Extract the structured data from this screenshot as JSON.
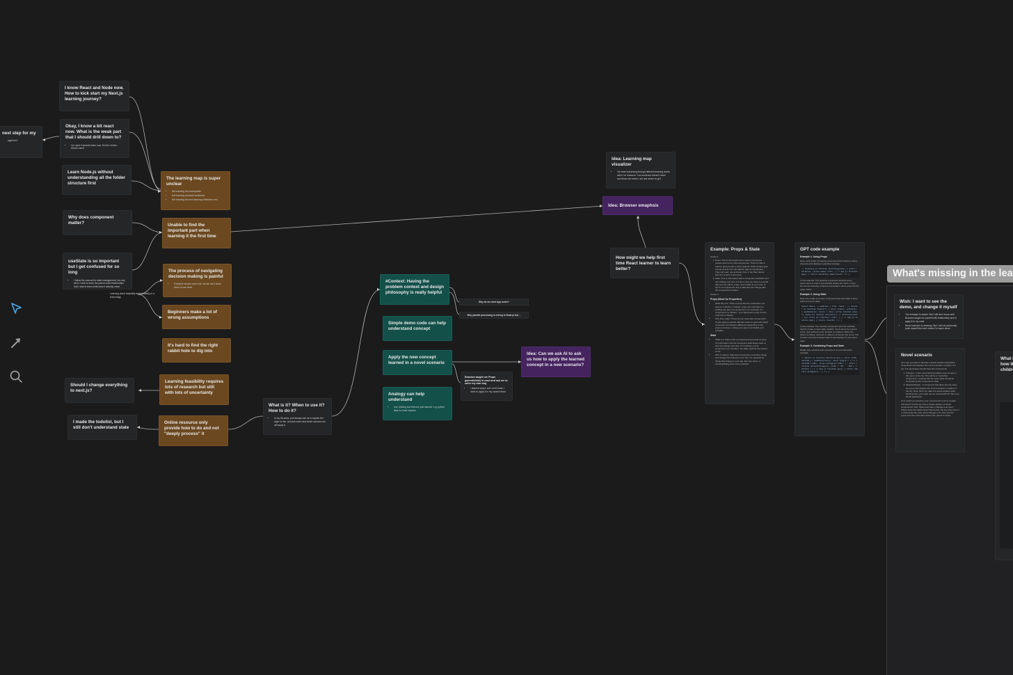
{
  "cards": {
    "next_step": {
      "title": "next step for my",
      "bullets": [
        "agement?"
      ]
    },
    "know_react_node": {
      "title": "I know React and Node now. How to kick start my Next.js learning journey?"
    },
    "weak_part": {
      "title": "Okay, I know a bit react now. What is the weak part that I should drill down to?",
      "bullets": [
        "I've used it several times now. So let's review. What's hard?"
      ]
    },
    "learn_node": {
      "title": "Learn Node.js without understanding all the folder structure first"
    },
    "component_matter": {
      "title": "Why does component matter?"
    },
    "usestate": {
      "title": "useState is so important but I get confused for so long",
      "bullets": [
        "I follow the manual for state management, but only when I start to learn the parent child relationships that I start to learn what does it actually mean"
      ]
    },
    "should_change": {
      "title": "Should I change everything to next.js?"
    },
    "made_todolist": {
      "title": "I made the todolist, but I still don't understand state"
    },
    "learning_map": {
      "title": "The learning map is super unclear",
      "bullets": [
        "Not knowing the prerequisite",
        "Not knowing personal weakness",
        "Not knowing the next learning milestone next"
      ]
    },
    "unable_find": {
      "title": "Unable to find the important part when learning it the first time"
    },
    "navigating": {
      "title": "The process of navigating decision making is painful",
      "bullets": [
        "Everyone knows some tool, but we don't know when to use what."
      ]
    },
    "beginners": {
      "title": "Beginners make a lot of wrong assumptions"
    },
    "rabbit_hole": {
      "title": "It's hard to find the right rabbit hole to dig into"
    },
    "feasibility": {
      "title": "Learning feasibility requires lots of research but still with lots of uncertainty"
    },
    "online_resource": {
      "title": "Online resource only provide how to do and not \"deeply process\" it"
    },
    "what_is_it": {
      "title": "What is it? When to use it? How to do it?",
      "bullets": [
        "In my 9A class, prof always ask us to explain the algor to him, and ask when and which scenario we will apply it."
      ]
    },
    "context": {
      "title": "#Context: Having the problem context and design philosophy is really helpful"
    },
    "simple_demo": {
      "title": "Simple demo code can help understand concept"
    },
    "apply_new": {
      "title": "Apply the new concept learned in a novel scenario"
    },
    "analogy": {
      "title": "Analogy can help understand",
      "bullets": [
        "Use existing tool that one just learned. e.g. python flask to Node express"
      ]
    },
    "brandon": {
      "title": "Brandon taught me Props (parent/child) in react and ask me to solve my own bug",
      "bullets": [
        "I learned props, but I don't know I need to apply it in my context there"
      ]
    },
    "idea_ai": {
      "title": "Idea: Can we ask AI to ask us how to apply the learned concept in a new scenario?"
    },
    "idea_map": {
      "title": "Idea: Learning map visualizer",
      "bullets": [
        "I've been traversing through different learning levels when I'm research. Can someone break it down and show me where I am and where to go?"
      ]
    },
    "idea_browser": {
      "title": "Idea: Browser emaphsis"
    },
    "how_might": {
      "title": "How might we help first time React learner to learn better?"
    },
    "wish": {
      "title": "Wish: I want to see the demo, and change it myself",
      "bullets": [
        "The example is simple. But I still don't know until Brandon taught me parent/child relationship and to apply it in my code.",
        "Novel scenario is amazing. But I will not personally push myself this hard unless I'm super stuck."
      ]
    },
    "novel": {
      "title": "Novel scenario",
      "body": "Let's say you want to develop a simple weather application using React that displays the current weather condition of a city. The application should have two components:",
      "items": [
        "CityInput - A form input field that allows users to type in the name of the city. This will be a \"controlled component\", meaning that the input value should be controlled by the component's state.",
        "WeatherDisplay - A component that takes the city name as a prop and displays the current weather condition of the city. Note: We'll not make the actual weather data fetching here, you might use an external API for that in an actual application."
      ],
      "foot": "How would you structure your components in terms of state and props? Could you write a simple skeleton of those components? Hint: What information changes over time? Where does information flow? Remember, the key thing here is to think about the state (what changes over time) and the props (how the information flows from parent to child)."
    },
    "partial": {
      "title": "What i how th childre"
    }
  },
  "tiny_notes": {
    "app_router": "Why do we need App router?",
    "parallel": "Why parallel processing is a thing in Node.js but ..."
  },
  "floating_label": "Learning about feasibility and suitability of a technology",
  "section_title": "What's missing in the lea",
  "docs": {
    "props_state": {
      "title": "Example: Props & State",
      "output1": "Output 1:",
      "p1": "Props: This is information that a parent component passes down to its child components. Think of it like a teacher giving books to their students. Each student gets a book (props) from the teacher (parent component). They can read, use and learn from it, but they cannot alter the content of the book.",
      "p2": "State: This is information that a component maintains and can change over time. It's like a note you write to yourself that you can add to, erase, and modify as you need. In terms of components, this is data that can change after the component is loaded.",
      "output2": "Output 2:",
      "props_head": "Props (Short for Properties)",
      "p3": "What they are: Think of props like the parameters you pass to a function. In React, props are information or settings you give to a component. For example, if a component is a \"Button\", you might pass a prop to tell it what text to display.",
      "p4": "Why they matter: Props let you customize components. It's like giving a painter different colors to paint with. Each component can behave differently depending on the props it receives, making your app more flexible and reusable.",
      "state_head": "State",
      "p5": "What it is: State is like a component's personal memory. It's information that the component itself keeps track of and can change over time. For instance, if your component is a \"Counter\", the state might be the current count.",
      "p6": "Why it matters: State lets components remember things and change their behavior over time. It's essential for things that change in your app, like user input, or showing/hiding parts of the interface."
    },
    "gpt_code": {
      "title": "GPT code example",
      "ex1": "Example 1: Using Props",
      "p1": "Here, we'll create a Greeting component that receives a name via props and displays a greeting message.",
      "code1": "// Greeting.js function Greeting(props) { return <h1>Hello, {props.name}!</h1>; } // App.js function App() { return <Greeting name=\"Alice\" />; }",
      "p2": "In this example: The Greeting component accepts props. props.name is used to dynamically display the name. In App, we use the Greeting component and pass a name prop with the value \"Alice\".",
      "ex2": "Example 2: Using State",
      "p3": "Now, let's create a Counter component that uses state to keep track of a count value.",
      "code2": "import React, { useState } from 'react'; // Counter.js function Counter() { const [count, setCount] = useState(0); return ( <div> <p>You clicked {count} times</p> <button onClick={() => setCount(count + 1)}> Click me </button> </div> ); } // App.js function App() { return <Counter />; }",
      "p4": "In this example: The Counter component uses the useState hook to create a count state variable. count stores the current count, and setCount is the function to update it. When the button is clicked, setCount is called to increment the count. The Counter component keeps track of and displays its own count state.",
      "ex3": "Example 3: Combining Props and State",
      "p5": "Finally, let's combine both concepts in a more interactive example.",
      "code3": "// Switch.js function Switch(props) { const [isOn, setIsOn] = useState(false); const toggle = () => { setIsOn(!isOn); props.onToggle(!isOn); }; return ( <button onClick={toggle}> {isOn ? 'ON' : 'OFF'} </button> ); } // App.js function App() { return <Switch onToggle={...} />; }"
    }
  },
  "toolbar": {
    "select_tool": "cursor-arrow-icon",
    "arrow_tool": "arrow-icon",
    "search_tool": "search-icon"
  },
  "colors": {
    "canvas": "#1b1b1c",
    "card_dark": "#252627",
    "card_brown": "#6b4820",
    "card_teal": "#14504a",
    "card_purple": "#45235f",
    "tool_active": "#4aa8e6"
  }
}
